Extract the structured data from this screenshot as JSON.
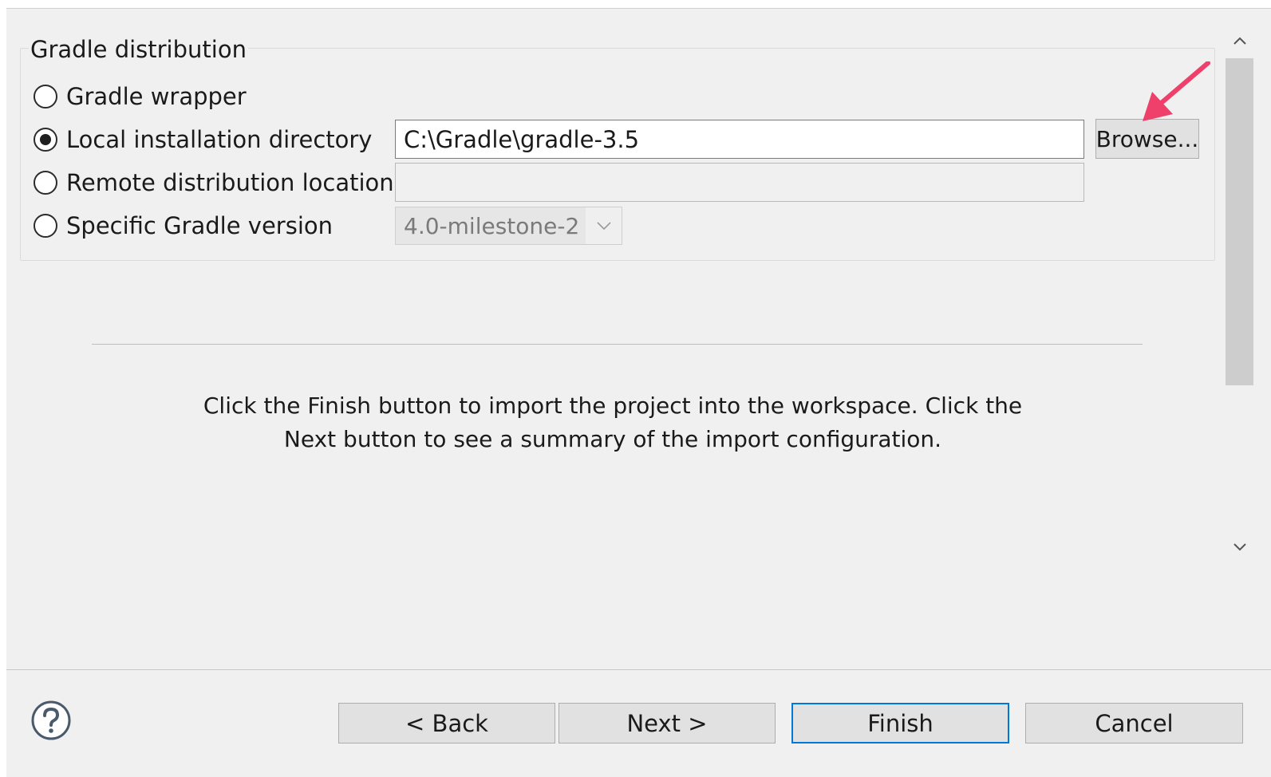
{
  "group": {
    "title": "Gradle distribution"
  },
  "options": {
    "wrapper": {
      "label": "Gradle wrapper",
      "checked": false
    },
    "local": {
      "label": "Local installation directory",
      "checked": true,
      "value": "C:\\Gradle\\gradle-3.5"
    },
    "remote": {
      "label": "Remote distribution location",
      "checked": false,
      "value": ""
    },
    "specific": {
      "label": "Specific Gradle version",
      "checked": false,
      "selected": "4.0-milestone-2"
    }
  },
  "browse_label": "Browse...",
  "info": {
    "line1": "Click the Finish button to import the project into the workspace. Click the",
    "line2": "Next button to see a summary of the import configuration."
  },
  "buttons": {
    "back": "< Back",
    "next": "Next >",
    "finish": "Finish",
    "cancel": "Cancel"
  },
  "colors": {
    "annotation_arrow": "#ef3f6b",
    "default_button_border": "#0078d7"
  },
  "icons": {
    "help": "help-icon",
    "chevron_down": "chevron-down-icon",
    "scroll_up": "chevron-up-icon",
    "scroll_down": "chevron-down-icon",
    "annotation": "annotation-arrow-icon"
  }
}
